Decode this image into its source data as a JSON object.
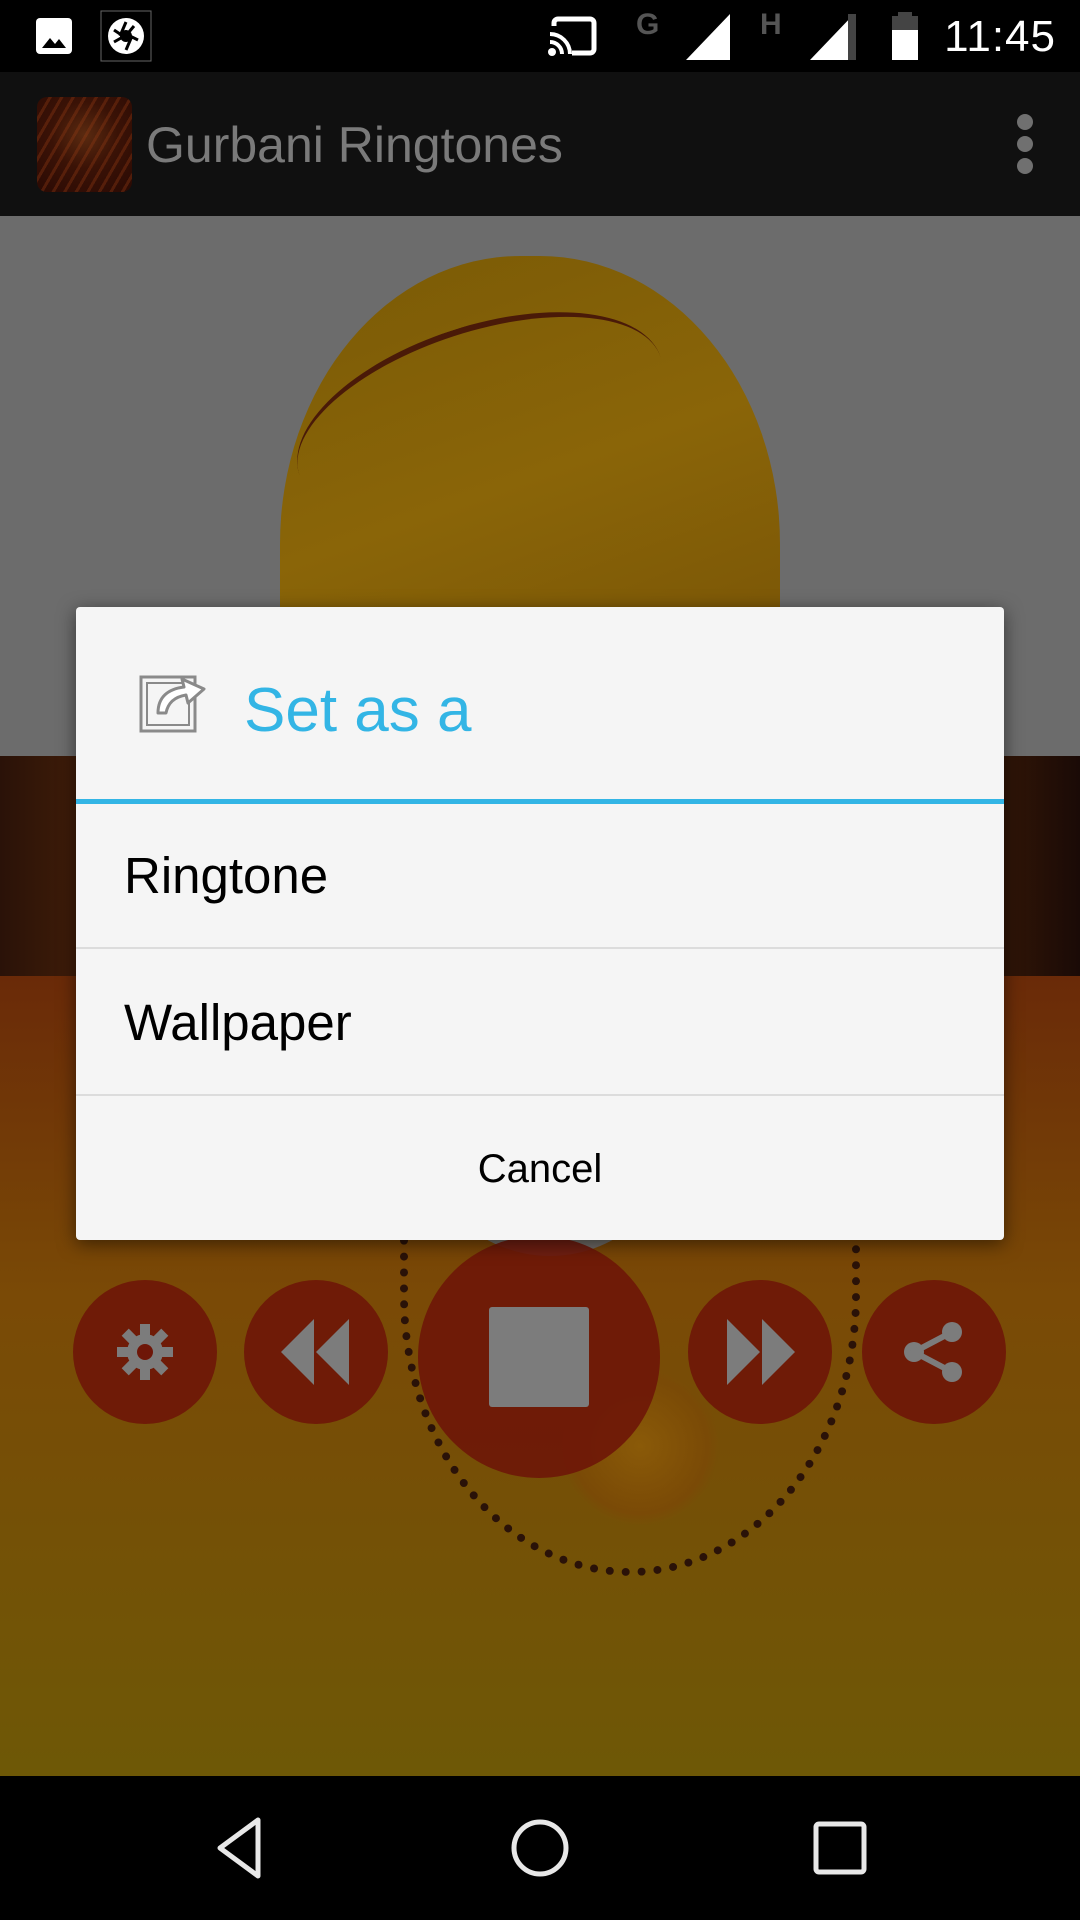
{
  "status_bar": {
    "time": "11:45",
    "icons": [
      "gallery-notification-icon",
      "screenshot-notification-icon",
      "cast-icon",
      "signal-g-icon",
      "signal-h-icon",
      "battery-icon"
    ],
    "network_labels": [
      "G",
      "H"
    ]
  },
  "app_bar": {
    "title": "Gurbani Ringtones",
    "overflow_icon": "more-vert-icon"
  },
  "player": {
    "controls": [
      {
        "name": "settings",
        "icon": "gear-icon"
      },
      {
        "name": "previous",
        "icon": "rewind-icon"
      },
      {
        "name": "stop",
        "icon": "stop-icon"
      },
      {
        "name": "next",
        "icon": "fast-forward-icon"
      },
      {
        "name": "share",
        "icon": "share-icon"
      }
    ]
  },
  "dialog": {
    "title": "Set as a",
    "title_icon": "share-arrow-icon",
    "accent_color": "#33b5e5",
    "options": [
      {
        "label": "Ringtone"
      },
      {
        "label": "Wallpaper"
      }
    ],
    "cancel_label": "Cancel"
  },
  "nav_bar": {
    "buttons": [
      "back-icon",
      "home-icon",
      "recents-icon"
    ]
  }
}
